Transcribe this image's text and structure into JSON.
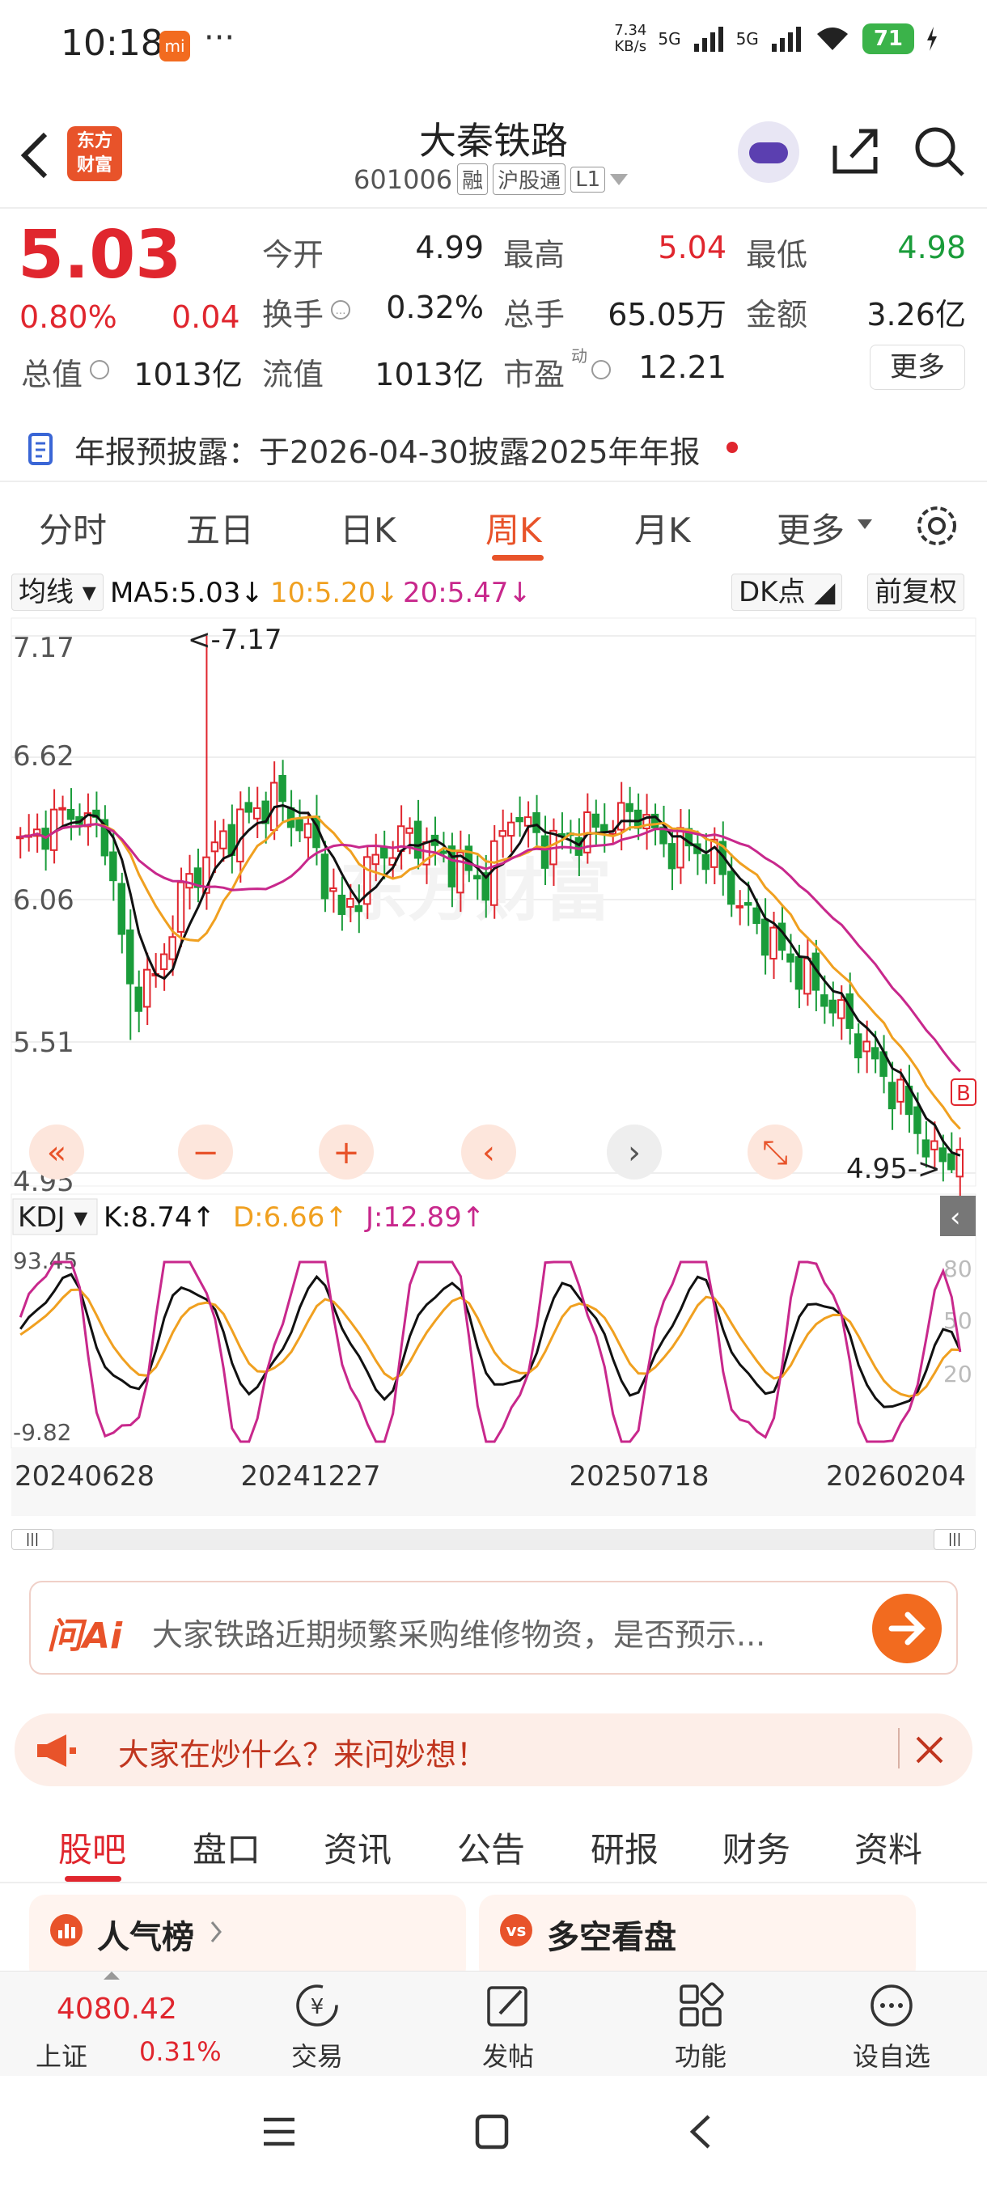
{
  "status_bar": {
    "time": "10:18",
    "mi_badge": "mi",
    "dots": "···",
    "speed": "7.34\nKB/s",
    "net1": "5G",
    "net2": "5G",
    "battery": "71"
  },
  "header": {
    "title": "大秦铁路",
    "code": "601006",
    "tag_rong": "融",
    "tag_hgt": "沪股通",
    "tag_l1": "L1",
    "logo_text": "东方\n财富"
  },
  "quote": {
    "price": "5.03",
    "change_pct": "0.80%",
    "change": "0.04",
    "open_label": "今开",
    "open": "4.99",
    "high_label": "最高",
    "high": "5.04",
    "low_label": "最低",
    "low": "4.98",
    "turnover_label": "换手",
    "turnover": "0.32%",
    "volume_label": "总手",
    "volume": "65.05万",
    "amount_label": "金额",
    "amount": "3.26亿",
    "mcap_label": "总值",
    "mcap": "1013亿",
    "float_label": "流值",
    "float": "1013亿",
    "pe_label": "市盈",
    "pe_sup": "动",
    "pe": "12.21",
    "more": "更多"
  },
  "notice": {
    "text": "年报预披露：于2026-04-30披露2025年年报"
  },
  "tabs": [
    "分时",
    "五日",
    "日K",
    "周K",
    "月K",
    "更多"
  ],
  "active_tab": 3,
  "chart_toolbar": {
    "ma_btn": "均线",
    "ma5": "MA5:5.03",
    "ma10": "10:5.20",
    "ma20": "20:5.47",
    "dk": "DK点",
    "fq": "前复权"
  },
  "chart_data": {
    "type": "candlestick",
    "y_ticks": [
      "7.17",
      "6.62",
      "6.06",
      "5.51",
      "4.95"
    ],
    "max_label": "<-7.17",
    "min_label": "4.95->",
    "watermark": "东方财富",
    "kdj": {
      "btn": "KDJ",
      "k": "K:8.74",
      "d": "D:6.66",
      "j": "J:12.89",
      "ticks_left": [
        "93.45",
        "-9.82"
      ],
      "ticks_right": [
        "80",
        "50",
        "20"
      ]
    },
    "x_labels": [
      "20240628",
      "20241227",
      "20250718",
      "20260204"
    ],
    "colors": {
      "up": "#e0262e",
      "down": "#1a9c3a",
      "ma5": "#111111",
      "ma10": "#f0a020",
      "ma20": "#c8288c"
    }
  },
  "ai": {
    "label": "问Ai",
    "placeholder": "大家铁路近期频繁采购维修物资，是否预示..."
  },
  "banner": {
    "text": "大家在炒什么？来问妙想！"
  },
  "subtabs": [
    "股吧",
    "盘口",
    "资讯",
    "公告",
    "研报",
    "财务",
    "资料"
  ],
  "cards": {
    "left": "人气榜",
    "right": "多空看盘"
  },
  "bottom_nav": {
    "index_value": "4080.42",
    "index_name": "上证",
    "index_pct": "0.31%",
    "trade": "交易",
    "post": "发帖",
    "func": "功能",
    "watch": "设自选"
  }
}
